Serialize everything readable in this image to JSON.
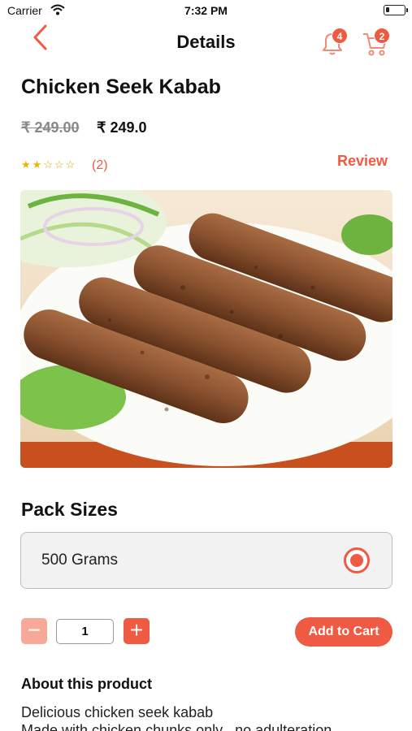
{
  "status_bar": {
    "carrier": "Carrier",
    "time": "7:32 PM"
  },
  "nav": {
    "title": "Details",
    "notifications_count": "4",
    "cart_count": "2"
  },
  "product": {
    "name": "Chicken Seek Kabab",
    "old_price": "₹ 249.00",
    "price": "₹ 249.0",
    "rating": 2,
    "rating_max": 5,
    "rating_count": "(2)",
    "review_label": "Review",
    "image_alt": "Seekh kababs on a plate with salad"
  },
  "pack": {
    "heading": "Pack Sizes",
    "options": [
      {
        "label": "500 Grams",
        "selected": true
      }
    ]
  },
  "quantity": {
    "value": "1",
    "minus": "−",
    "plus": "+"
  },
  "actions": {
    "add_to_cart": "Add to Cart"
  },
  "about": {
    "heading": "About this product",
    "line1": "Delicious chicken seek kabab",
    "line2": "Made with chicken chunks only , no adulteration"
  },
  "colors": {
    "accent": "#ef5a43",
    "accent_light": "#f7a999",
    "star": "#f0b400"
  },
  "icons": [
    "wifi-icon",
    "battery-icon",
    "back-chevron-icon",
    "bell-icon",
    "cart-icon",
    "star-icon",
    "radio-selected-icon"
  ]
}
